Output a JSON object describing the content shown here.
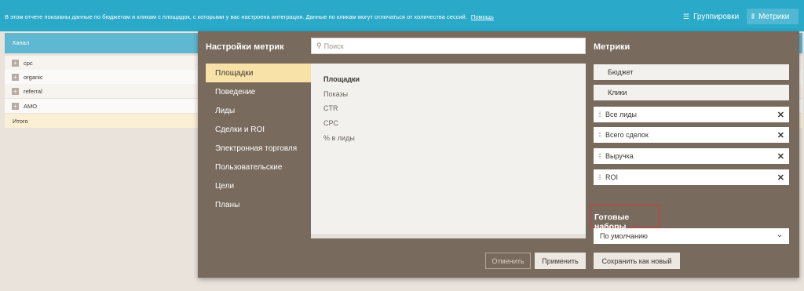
{
  "topbar": {
    "info_text": "В этом отчете показаны данные по бюджетам и кликам с площадок, с которыми у вас настроена интеграция. Данные по кликам могут отличаться от количества сессий.",
    "help_link": "Помощь",
    "group_label": "Группировки",
    "metrics_label": "Метрики"
  },
  "report": {
    "column_header": "Канал",
    "rows": [
      "cpc",
      "organic",
      "referral",
      "AMO"
    ],
    "total_label": "Итого"
  },
  "modal": {
    "title": "Настройки метрик",
    "search_placeholder": "Поиск",
    "metrics_title": "Метрики",
    "categories": [
      "Площадки",
      "Поведение",
      "Лиды",
      "Сделки и ROI",
      "Электронная торговля",
      "Пользовательские",
      "Цели",
      "Планы"
    ],
    "active_category": "Площадки",
    "field_group": "Площадки",
    "fields": [
      "Показы",
      "CTR",
      "CPC",
      "% в лиды"
    ],
    "selected_fixed": [
      "Бюджет",
      "Клики"
    ],
    "selected_removable": [
      "Все лиды",
      "Всего сделок",
      "Выручка",
      "ROI"
    ],
    "presets_title": "Готовые наборы",
    "preset_value": "По умолчанию",
    "cancel_label": "Отменить",
    "apply_label": "Применить",
    "save_new_label": "Сохранить как новый"
  },
  "colors": {
    "topbar": "#2aa9c9",
    "modal_bg": "#786a5c",
    "active_category": "#f9e2a8",
    "highlight_border": "#d43a3a"
  },
  "icons": [
    "filter-lines-icon",
    "bars-icon",
    "search-icon",
    "expand-plus-icon",
    "drag-handle-icon",
    "close-icon",
    "chevron-down-icon"
  ]
}
